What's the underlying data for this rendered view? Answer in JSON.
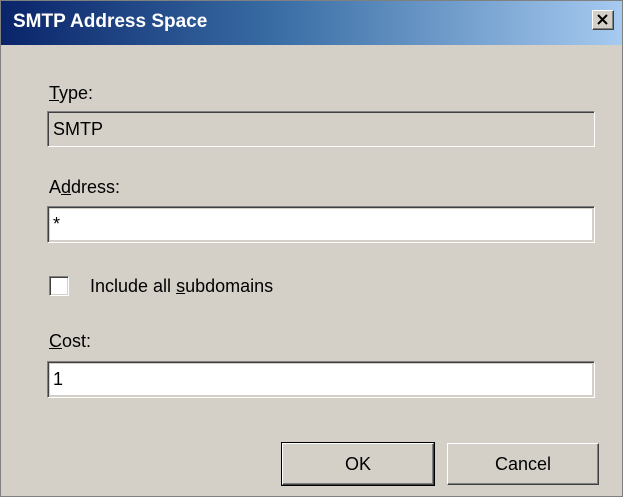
{
  "window": {
    "title": "SMTP Address Space"
  },
  "type_section": {
    "label_mnemonic": "T",
    "label_rest": "ype:",
    "value": "SMTP"
  },
  "address_section": {
    "label_pre": "A",
    "label_mnemonic": "d",
    "label_rest": "dress:",
    "value": "*"
  },
  "subdomains": {
    "label_pre": "Include all ",
    "label_mnemonic": "s",
    "label_rest": "ubdomains",
    "checked": false
  },
  "cost_section": {
    "label_mnemonic": "C",
    "label_rest": "ost:",
    "value": "1"
  },
  "buttons": {
    "ok_label": "OK",
    "cancel_label": "Cancel"
  },
  "icons": {
    "close": "close-icon"
  }
}
